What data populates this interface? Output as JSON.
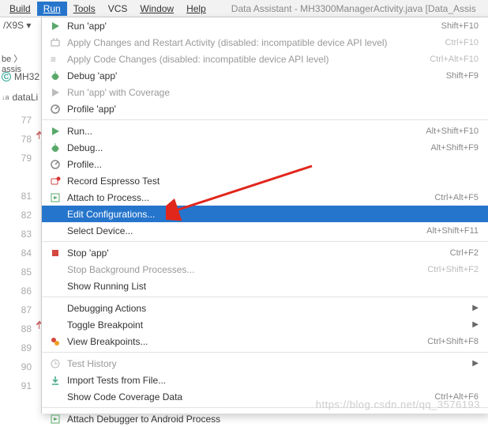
{
  "menubar": {
    "items": [
      "Build",
      "Run",
      "Tools",
      "VCS",
      "Window",
      "Help"
    ],
    "active_index": 1,
    "title": "Data Assistant - MH3300ManagerActivity.java [Data_Assis"
  },
  "left": {
    "device": "/X9S ▾",
    "crumb": "be 〉 assis",
    "file_icon": "C",
    "file_label": "MH32",
    "structure_icon": "↓a",
    "structure_label": "dataLi"
  },
  "gutter": {
    "lines": [
      {
        "n": "77",
        "mark": ""
      },
      {
        "n": "78",
        "mark": "up"
      },
      {
        "n": "79",
        "mark": ""
      },
      {
        "n": "",
        "mark": ""
      },
      {
        "n": "81",
        "mark": ""
      },
      {
        "n": "82",
        "mark": ""
      },
      {
        "n": "83",
        "mark": ""
      },
      {
        "n": "84",
        "mark": ""
      },
      {
        "n": "85",
        "mark": ""
      },
      {
        "n": "86",
        "mark": ""
      },
      {
        "n": "87",
        "mark": ""
      },
      {
        "n": "88",
        "mark": "up"
      },
      {
        "n": "89",
        "mark": ""
      },
      {
        "n": "90",
        "mark": ""
      },
      {
        "n": "91",
        "mark": ""
      }
    ]
  },
  "menu": {
    "items": [
      {
        "icon": "play-green",
        "label": "Run 'app'",
        "shortcut": "Shift+F10",
        "disabled": false
      },
      {
        "icon": "apply-gray",
        "label": "Apply Changes and Restart Activity (disabled: incompatible device API level)",
        "shortcut": "Ctrl+F10",
        "disabled": true
      },
      {
        "icon": "code-gray",
        "label": "Apply Code Changes (disabled: incompatible device API level)",
        "shortcut": "Ctrl+Alt+F10",
        "disabled": true
      },
      {
        "icon": "bug-green",
        "label": "Debug 'app'",
        "shortcut": "Shift+F9",
        "disabled": false
      },
      {
        "icon": "play-cover-gray",
        "label": "Run 'app' with Coverage",
        "shortcut": "",
        "disabled": true
      },
      {
        "icon": "profile",
        "label": "Profile 'app'",
        "shortcut": "",
        "disabled": false
      },
      {
        "sep": true
      },
      {
        "icon": "play-green",
        "label": "Run...",
        "shortcut": "Alt+Shift+F10",
        "disabled": false
      },
      {
        "icon": "bug-green",
        "label": "Debug...",
        "shortcut": "Alt+Shift+F9",
        "disabled": false
      },
      {
        "icon": "profile",
        "label": "Profile...",
        "shortcut": "",
        "disabled": false
      },
      {
        "icon": "record-red",
        "label": "Record Espresso Test",
        "shortcut": "",
        "disabled": false
      },
      {
        "icon": "attach-green",
        "label": "Attach to Process...",
        "shortcut": "Ctrl+Alt+F5",
        "disabled": false
      },
      {
        "icon": "",
        "label": "Edit Configurations...",
        "shortcut": "",
        "disabled": false,
        "selected": true
      },
      {
        "icon": "",
        "label": "Select Device...",
        "shortcut": "Alt+Shift+F11",
        "disabled": false
      },
      {
        "sep": true
      },
      {
        "icon": "stop-red",
        "label": "Stop 'app'",
        "shortcut": "Ctrl+F2",
        "disabled": false
      },
      {
        "icon": "",
        "label": "Stop Background Processes...",
        "shortcut": "Ctrl+Shift+F2",
        "disabled": true
      },
      {
        "icon": "",
        "label": "Show Running List",
        "shortcut": "",
        "disabled": false
      },
      {
        "sep": true
      },
      {
        "icon": "",
        "label": "Debugging Actions",
        "shortcut": "",
        "submenu": true,
        "disabled": false
      },
      {
        "icon": "",
        "label": "Toggle Breakpoint",
        "shortcut": "",
        "submenu": true,
        "disabled": false
      },
      {
        "icon": "breakpoints",
        "label": "View Breakpoints...",
        "shortcut": "Ctrl+Shift+F8",
        "disabled": false
      },
      {
        "sep": true
      },
      {
        "icon": "clock-gray",
        "label": "Test History",
        "shortcut": "",
        "submenu": true,
        "disabled": true
      },
      {
        "icon": "import",
        "label": "Import Tests from File...",
        "shortcut": "",
        "disabled": false
      },
      {
        "icon": "",
        "label": "Show Code Coverage Data",
        "shortcut": "Ctrl+Alt+F6",
        "disabled": false
      },
      {
        "sep": true
      },
      {
        "icon": "attach-green",
        "label": "Attach Debugger to Android Process",
        "shortcut": "",
        "disabled": false
      }
    ]
  },
  "watermark": "https://blog.csdn.net/qq_3576193"
}
